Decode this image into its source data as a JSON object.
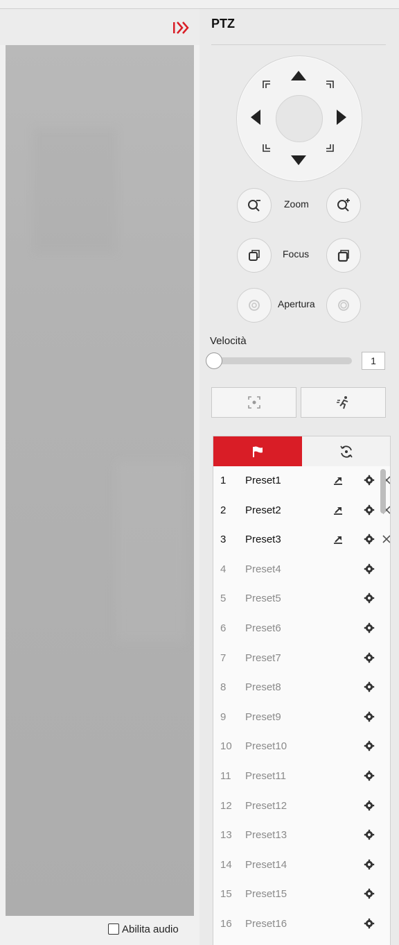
{
  "panel": {
    "title": "PTZ"
  },
  "controls": {
    "zoom_label": "Zoom",
    "focus_label": "Focus",
    "iris_label": "Apertura",
    "speed_label": "Velocità",
    "speed_value": "1",
    "speed_level": 0.0
  },
  "video": {
    "audio_label": "Abilita audio",
    "audio_enabled": false
  },
  "tabs": [
    {
      "icon": "flag-icon",
      "active": true
    },
    {
      "icon": "patrol-cycle-icon",
      "active": false
    }
  ],
  "presets": [
    {
      "num": "1",
      "name": "Preset1",
      "defined": true
    },
    {
      "num": "2",
      "name": "Preset2",
      "defined": true
    },
    {
      "num": "3",
      "name": "Preset3",
      "defined": true
    },
    {
      "num": "4",
      "name": "Preset4",
      "defined": false
    },
    {
      "num": "5",
      "name": "Preset5",
      "defined": false
    },
    {
      "num": "6",
      "name": "Preset6",
      "defined": false
    },
    {
      "num": "7",
      "name": "Preset7",
      "defined": false
    },
    {
      "num": "8",
      "name": "Preset8",
      "defined": false
    },
    {
      "num": "9",
      "name": "Preset9",
      "defined": false
    },
    {
      "num": "10",
      "name": "Preset10",
      "defined": false
    },
    {
      "num": "11",
      "name": "Preset11",
      "defined": false
    },
    {
      "num": "12",
      "name": "Preset12",
      "defined": false
    },
    {
      "num": "13",
      "name": "Preset13",
      "defined": false
    },
    {
      "num": "14",
      "name": "Preset14",
      "defined": false
    },
    {
      "num": "15",
      "name": "Preset15",
      "defined": false
    },
    {
      "num": "16",
      "name": "Preset16",
      "defined": false
    }
  ],
  "colors": {
    "accent": "#d91d26",
    "icon": "#444444",
    "muted_text": "#8a8a8a"
  }
}
